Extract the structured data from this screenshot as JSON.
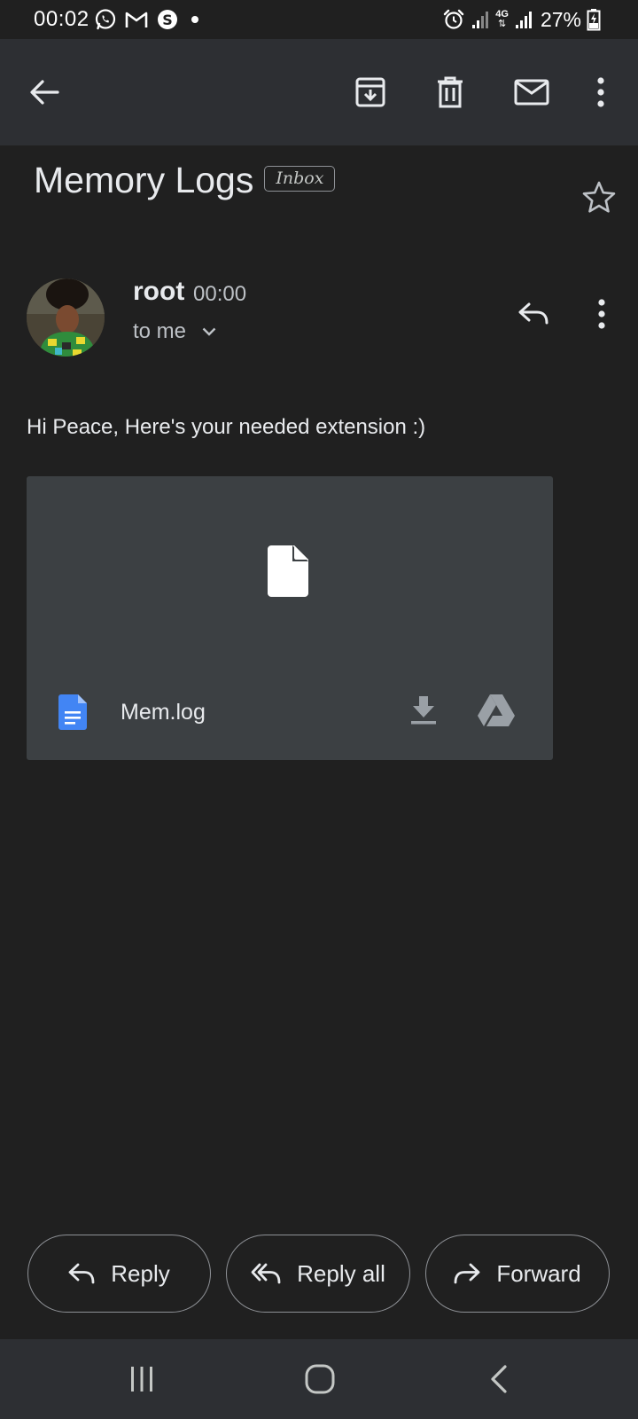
{
  "status_bar": {
    "time": "00:02",
    "battery": "27%",
    "network": "4G",
    "left_icons": [
      "whatsapp-icon",
      "gmail-icon",
      "skype-icon",
      "notification-dot"
    ],
    "right_icons": [
      "alarm-icon",
      "signal-icon",
      "data-icon",
      "signal-icon",
      "battery-charging-icon"
    ]
  },
  "toolbar": {
    "back_icon": "arrow-back-icon",
    "actions": [
      "archive-icon",
      "delete-icon",
      "mark-unread-icon",
      "more-vert-icon"
    ]
  },
  "email": {
    "subject": "Memory Logs",
    "label": "Inbox",
    "starred": false,
    "sender": {
      "name": "root",
      "time": "00:00",
      "recipient": "to me"
    },
    "body": "Hi Peace, Here's your needed extension :)",
    "attachment": {
      "name": "Mem.log",
      "preview_icon": "file-icon",
      "type_icon": "document-icon",
      "actions": [
        "download-icon",
        "drive-icon"
      ]
    }
  },
  "actions": {
    "reply": "Reply",
    "reply_all": "Reply all",
    "forward": "Forward"
  },
  "nav_bar": [
    "recents-icon",
    "home-icon",
    "back-icon"
  ],
  "colors": {
    "background": "#202020",
    "toolbar": "#2d2f33",
    "attachment_card": "#3c4043",
    "doc_icon_blue": "#4285f4",
    "text": "#e8eaed",
    "secondary_text": "#bdc1c6"
  }
}
